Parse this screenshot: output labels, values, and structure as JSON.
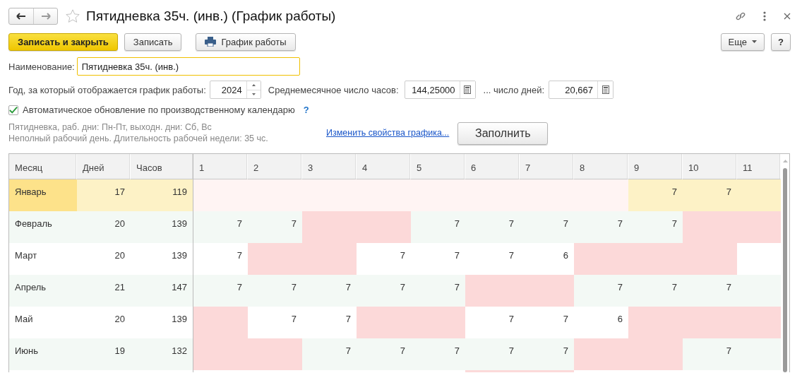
{
  "window": {
    "title": "Пятидневка 35ч. (инв.) (График работы)",
    "favorite": false
  },
  "toolbar": {
    "buttons": [
      {
        "label": "Записать и закрыть",
        "kind": "primary"
      },
      {
        "label": "Записать",
        "kind": "plain"
      },
      {
        "label": "График работы",
        "kind": "print"
      }
    ],
    "more": "Еще",
    "help": "?"
  },
  "name_field": {
    "label": "Наименование:",
    "value": "Пятидневка 35ч. (инв.)"
  },
  "year_field": {
    "label": "Год, за который отображается график работы:",
    "value": "2024"
  },
  "avg_hours": {
    "label": "Среднемесячное число часов:",
    "value": "144,25000"
  },
  "avg_days": {
    "label": "... число дней:",
    "value": "20,667"
  },
  "auto_update": {
    "label": "Автоматическое обновление по производственному календарю",
    "checked": true,
    "help": "?"
  },
  "description": [
    "Пятидневка, раб. дни: Пн-Пт, выходн. дни: Сб, Вс",
    "Неполный рабочий день. Длительность рабочей недели: 35 чс."
  ],
  "change_link": "Изменить свойства графика...",
  "fill_button": "Заполнить",
  "table": {
    "columns": [
      "Месяц",
      "Дней",
      "Часов"
    ],
    "day_columns": [
      "1",
      "2",
      "3",
      "4",
      "5",
      "6",
      "7",
      "8",
      "9",
      "10",
      "11"
    ],
    "rows": [
      {
        "month": "Январь",
        "days": "17",
        "hours": "119",
        "selected": true,
        "cells": [
          {
            "holiday": true
          },
          {
            "holiday": true
          },
          {
            "holiday": true
          },
          {
            "holiday": true
          },
          {
            "holiday": true
          },
          {
            "holiday": true
          },
          {
            "holiday": true
          },
          {
            "holiday": true
          },
          {
            "holiday": false,
            "value": "7"
          },
          {
            "holiday": false,
            "value": "7"
          },
          {
            "holiday": false
          }
        ]
      },
      {
        "month": "Февраль",
        "days": "20",
        "hours": "139",
        "selected": false,
        "cells": [
          {
            "holiday": false,
            "value": "7"
          },
          {
            "holiday": false,
            "value": "7"
          },
          {
            "holiday": true
          },
          {
            "holiday": true
          },
          {
            "holiday": false,
            "value": "7"
          },
          {
            "holiday": false,
            "value": "7"
          },
          {
            "holiday": false,
            "value": "7"
          },
          {
            "holiday": false,
            "value": "7"
          },
          {
            "holiday": false,
            "value": "7"
          },
          {
            "holiday": true
          },
          {
            "holiday": true
          }
        ]
      },
      {
        "month": "Март",
        "days": "20",
        "hours": "139",
        "selected": false,
        "cells": [
          {
            "holiday": false,
            "value": "7"
          },
          {
            "holiday": true
          },
          {
            "holiday": true
          },
          {
            "holiday": false,
            "value": "7"
          },
          {
            "holiday": false,
            "value": "7"
          },
          {
            "holiday": false,
            "value": "7"
          },
          {
            "holiday": false,
            "value": "6"
          },
          {
            "holiday": true
          },
          {
            "holiday": true
          },
          {
            "holiday": true
          },
          {
            "holiday": false
          }
        ]
      },
      {
        "month": "Апрель",
        "days": "21",
        "hours": "147",
        "selected": false,
        "cells": [
          {
            "holiday": false,
            "value": "7"
          },
          {
            "holiday": false,
            "value": "7"
          },
          {
            "holiday": false,
            "value": "7"
          },
          {
            "holiday": false,
            "value": "7"
          },
          {
            "holiday": false,
            "value": "7"
          },
          {
            "holiday": true
          },
          {
            "holiday": true
          },
          {
            "holiday": false,
            "value": "7"
          },
          {
            "holiday": false,
            "value": "7"
          },
          {
            "holiday": false,
            "value": "7"
          },
          {
            "holiday": false
          }
        ]
      },
      {
        "month": "Май",
        "days": "20",
        "hours": "139",
        "selected": false,
        "cells": [
          {
            "holiday": true
          },
          {
            "holiday": false,
            "value": "7"
          },
          {
            "holiday": false,
            "value": "7"
          },
          {
            "holiday": true
          },
          {
            "holiday": true
          },
          {
            "holiday": false,
            "value": "7"
          },
          {
            "holiday": false,
            "value": "7"
          },
          {
            "holiday": false,
            "value": "6"
          },
          {
            "holiday": true
          },
          {
            "holiday": true
          },
          {
            "holiday": true
          }
        ]
      },
      {
        "month": "Июнь",
        "days": "19",
        "hours": "132",
        "selected": false,
        "cells": [
          {
            "holiday": true
          },
          {
            "holiday": true
          },
          {
            "holiday": false,
            "value": "7"
          },
          {
            "holiday": false,
            "value": "7"
          },
          {
            "holiday": false,
            "value": "7"
          },
          {
            "holiday": false,
            "value": "7"
          },
          {
            "holiday": false,
            "value": "7"
          },
          {
            "holiday": true
          },
          {
            "holiday": true
          },
          {
            "holiday": false,
            "value": "7"
          },
          {
            "holiday": false
          }
        ]
      },
      {
        "selected": false,
        "cells": [
          {
            "holiday": false
          },
          {
            "holiday": false
          },
          {
            "holiday": false
          },
          {
            "holiday": false
          },
          {
            "holiday": false
          },
          {
            "holiday": true
          },
          {
            "holiday": true
          },
          {
            "holiday": false
          },
          {
            "holiday": false
          },
          {
            "holiday": false
          },
          {
            "holiday": false
          }
        ]
      }
    ]
  }
}
